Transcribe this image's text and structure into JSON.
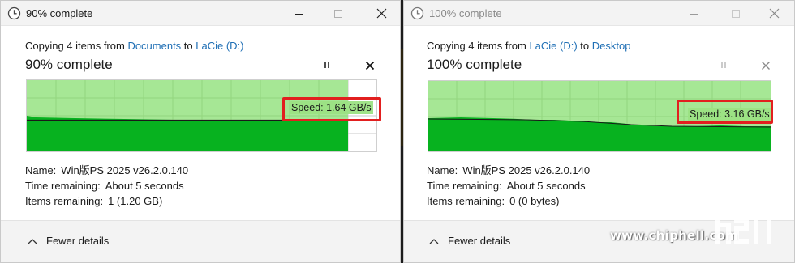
{
  "colors": {
    "link": "#1f6fb5",
    "graph_fill_light": "#a6e795",
    "graph_fill_dark": "#07b21f",
    "highlight_red": "#e21f1f"
  },
  "windows": [
    {
      "title": "90% complete",
      "copy_prefix": "Copying 4 items from ",
      "source": "Documents",
      "copy_to": " to ",
      "destination": "LaCie (D:)",
      "heading": "90% complete",
      "progress": 0.9,
      "speed": "Speed: 1.64 GB/s",
      "name_label": "Name:",
      "name_value": "Win版PS 2025 v26.2.0.140",
      "time_label": "Time remaining:",
      "time_value": "About 5 seconds",
      "items_label": "Items remaining:",
      "items_value": "1 (1.20 GB)",
      "fewer_details": "Fewer details",
      "icons": {
        "app": "clock-icon",
        "minimize": "minimize-icon",
        "maximize": "maximize-icon",
        "close": "close-icon",
        "pause": "pause-icon",
        "cancel": "cancel-icon",
        "toggle": "chevron-up-icon"
      }
    },
    {
      "title": "100% complete",
      "copy_prefix": "Copying 4 items from ",
      "source": "LaCie (D:)",
      "copy_to": " to ",
      "destination": "Desktop",
      "heading": "100% complete",
      "progress": 1.0,
      "speed": "Speed: 3.16 GB/s",
      "name_label": "Name:",
      "name_value": "Win版PS 2025 v26.2.0.140",
      "time_label": "Time remaining:",
      "time_value": "About 5 seconds",
      "items_label": "Items remaining:",
      "items_value": "0 (0 bytes)",
      "fewer_details": "Fewer details",
      "icons": {
        "app": "clock-icon",
        "minimize": "minimize-icon",
        "maximize": "maximize-icon",
        "close": "close-icon",
        "pause": "pause-icon",
        "cancel": "cancel-icon",
        "toggle": "chevron-up-icon"
      }
    }
  ],
  "watermark": {
    "url": "www.chiphell.com",
    "logo_text": "chiphell"
  }
}
